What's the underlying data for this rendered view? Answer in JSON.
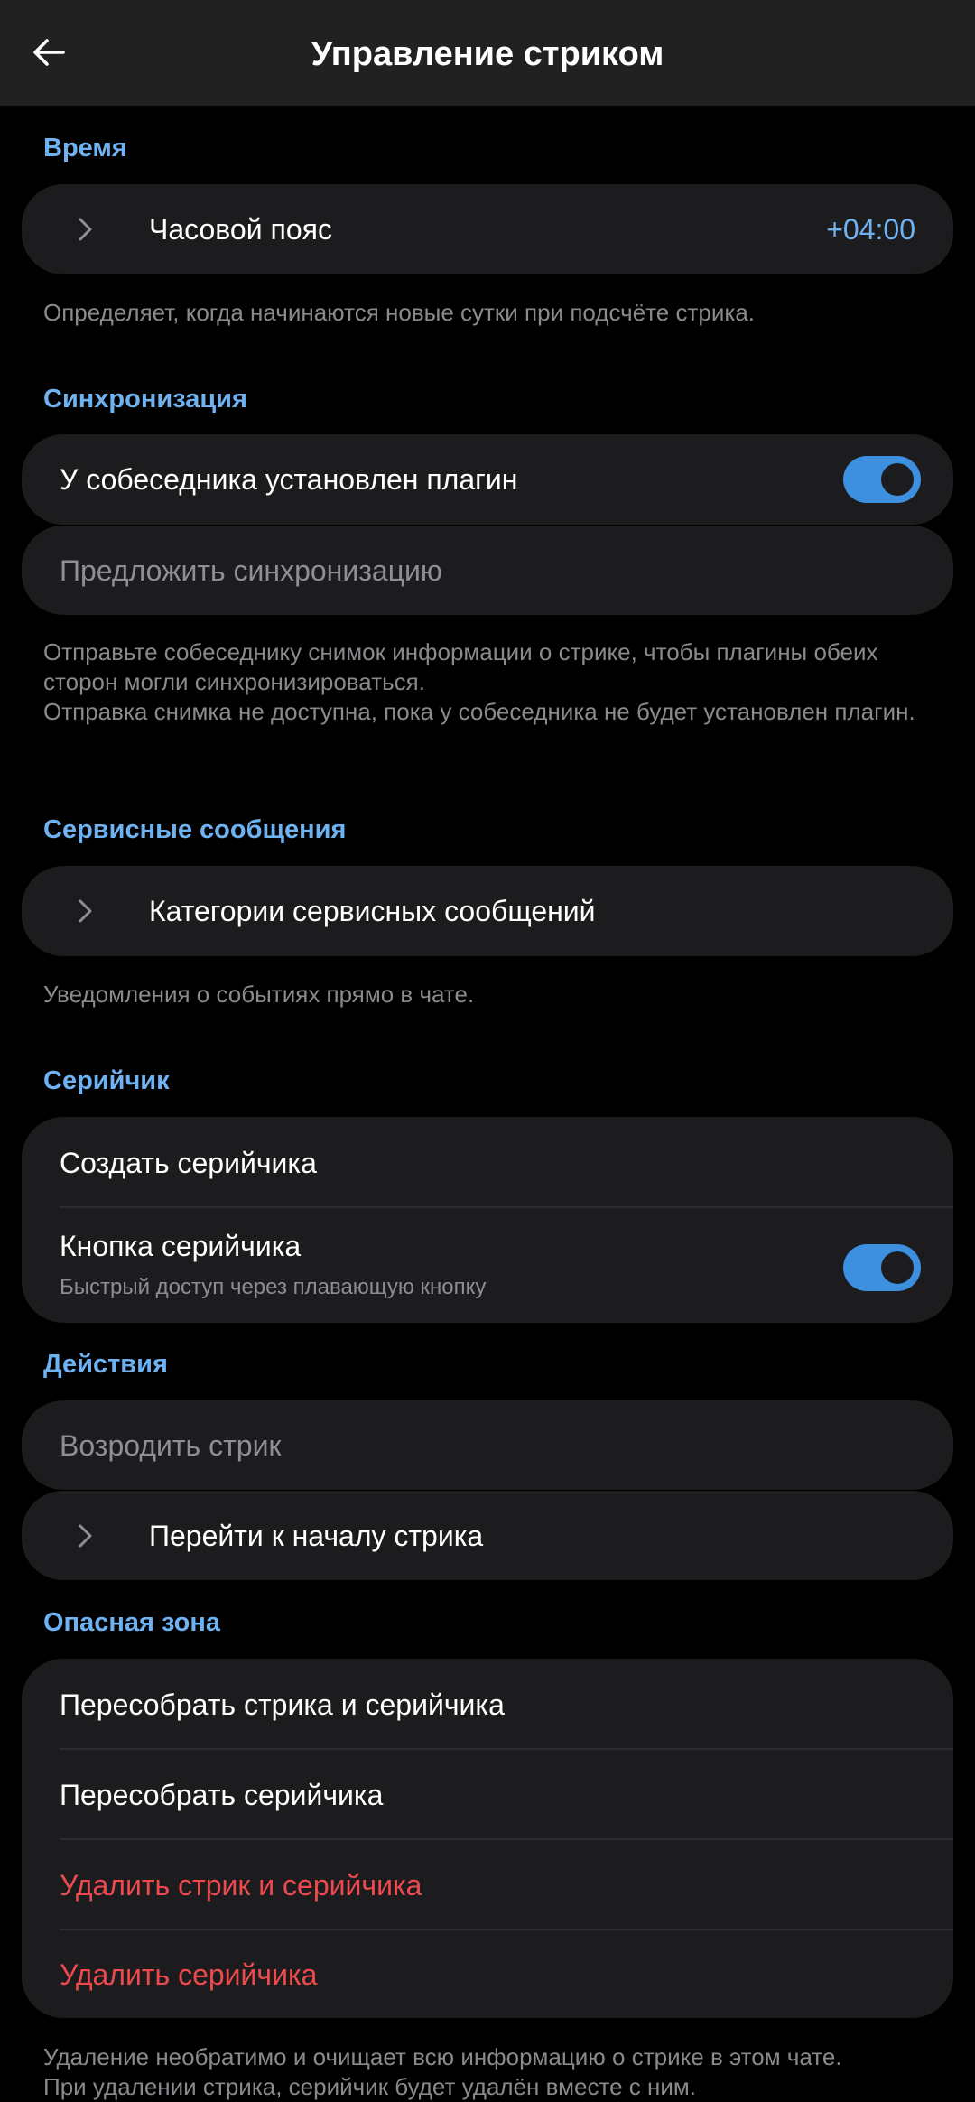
{
  "header": {
    "title": "Управление стриком"
  },
  "time": {
    "section_title": "Время",
    "timezone_label": "Часовой пояс",
    "timezone_value": "+04:00",
    "note": "Определяет, когда начинаются новые сутки при подсчёте стрика."
  },
  "sync": {
    "section_title": "Синхронизация",
    "plugin_installed_label": "У собеседника установлен плагин",
    "plugin_installed_on": true,
    "offer_sync_label": "Предложить синхронизацию",
    "note_1": "Отправьте собеседнику снимок информации о стрике, чтобы плагины обеих сторон могли синхронизироваться.",
    "note_2": "Отправка снимка не доступна, пока у собеседника не будет установлен плагин."
  },
  "service": {
    "section_title": "Сервисные сообщения",
    "categories_label": "Категории сервисных сообщений",
    "note": "Уведомления о событиях прямо в чате."
  },
  "pet": {
    "section_title": "Серийчик",
    "create_label": "Создать серийчика",
    "button_label": "Кнопка серийчика",
    "button_sub": "Быстрый доступ через плавающую кнопку",
    "button_on": true
  },
  "actions": {
    "section_title": "Действия",
    "revive_label": "Возродить стрик",
    "goto_start_label": "Перейти к началу стрика"
  },
  "danger": {
    "section_title": "Опасная зона",
    "rebuild_both_label": "Пересобрать стрика и серийчика",
    "rebuild_pet_label": "Пересобрать серийчика",
    "delete_both_label": "Удалить стрик и серийчика",
    "delete_pet_label": "Удалить серийчика",
    "note_1": "Удаление необратимо и очищает всю информацию о стрике в этом чате.",
    "note_2": "При удалении стрика, серийчик будет удалён вместе с ним."
  },
  "colors": {
    "accent": "#6fb2f2",
    "toggle_on": "#3d8fe0",
    "danger": "#ec4a4c",
    "card": "#1c1c1e",
    "topbar": "#212121"
  }
}
